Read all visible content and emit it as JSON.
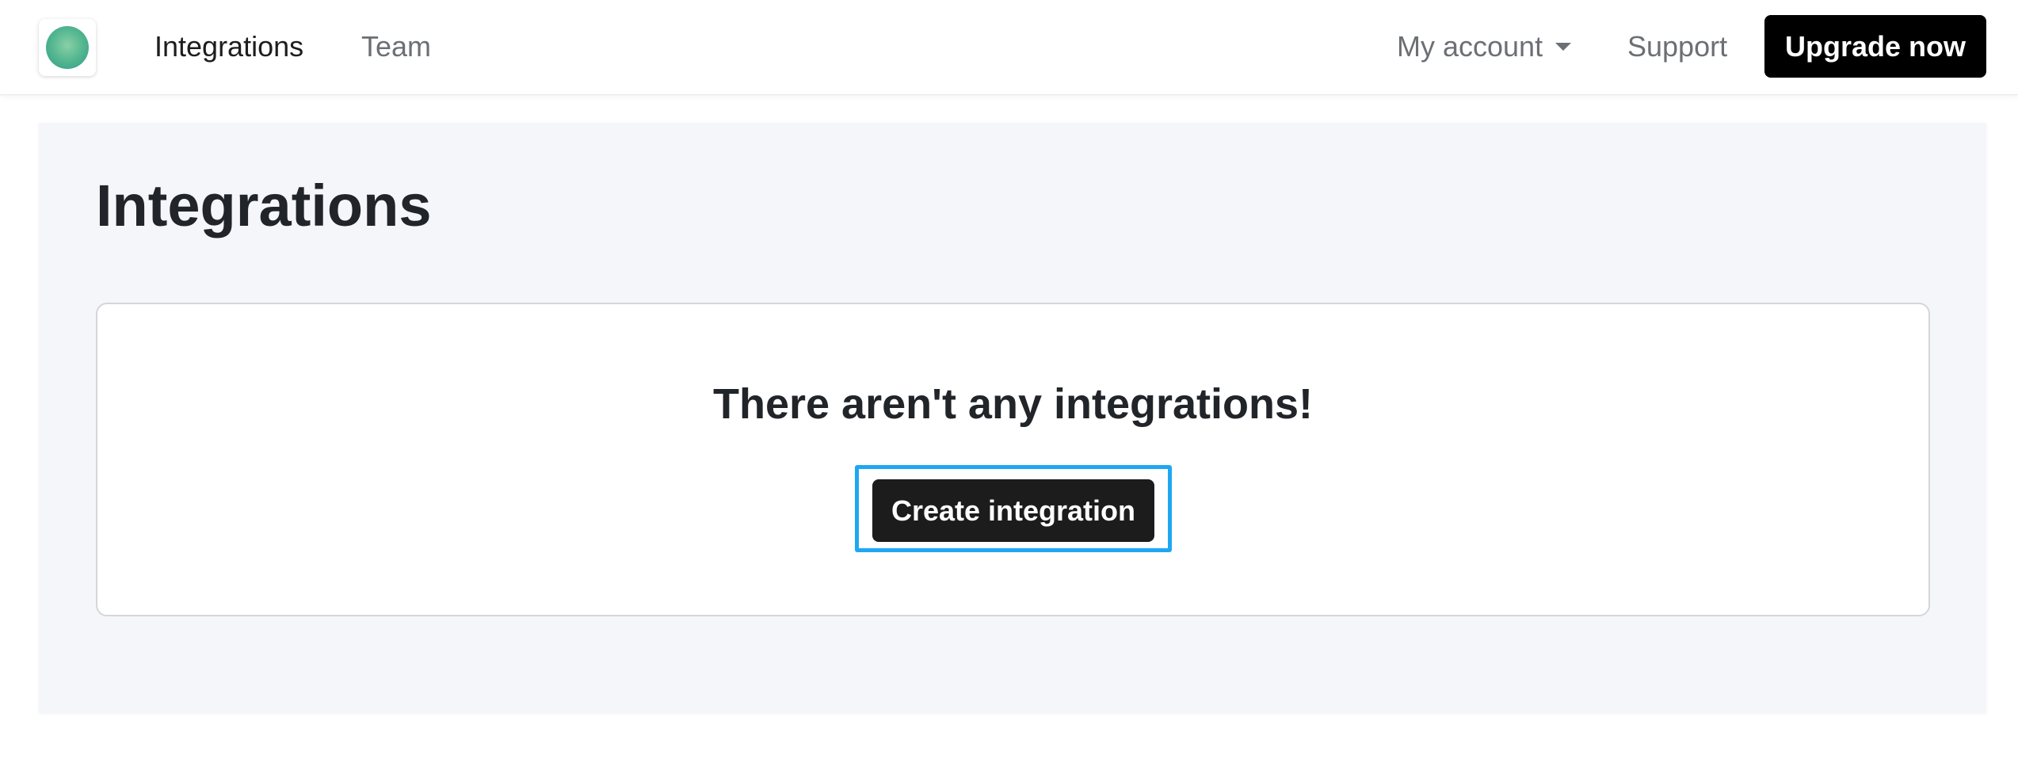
{
  "nav": {
    "links": [
      {
        "label": "Integrations",
        "active": true
      },
      {
        "label": "Team",
        "active": false
      }
    ],
    "account_label": "My account",
    "support_label": "Support",
    "upgrade_label": "Upgrade now"
  },
  "logo": {
    "icon": "green-circle-logo-icon",
    "color": "#58b992"
  },
  "main": {
    "title": "Integrations",
    "empty_state": {
      "message": "There aren't any integrations!",
      "create_button_label": "Create integration",
      "focus_color": "#1ea7f2"
    }
  },
  "colors": {
    "nav_active_text": "#1d1d1f",
    "nav_muted_text": "#6c6f73",
    "button_bg": "#000000",
    "panel_bg": "#f5f6f9"
  }
}
